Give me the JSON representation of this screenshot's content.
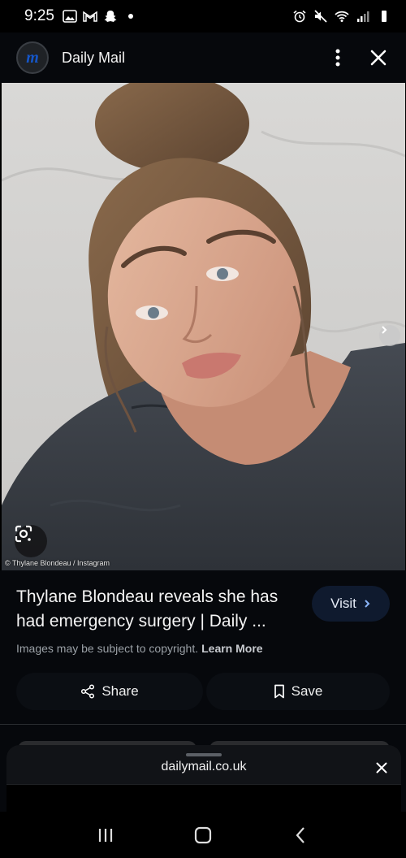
{
  "status_bar": {
    "time": "9:25",
    "left_icons": [
      "gallery-icon",
      "gmail-icon",
      "snapchat-icon",
      "dot-icon"
    ],
    "right_icons": [
      "alarm-icon",
      "mute-icon",
      "wifi-icon",
      "signal-icon",
      "battery-icon"
    ]
  },
  "header": {
    "logo_letter": "m",
    "title": "Daily Mail",
    "menu_icon": "more-vert-icon",
    "close_icon": "close-icon"
  },
  "image": {
    "credit": "© Thylane Blondeau / Instagram",
    "lens_icon": "google-lens-icon",
    "next_icon": "chevron-right-icon"
  },
  "result": {
    "title": "Thylane Blondeau reveals she has had emergency surgery | Daily ...",
    "visit_label": "Visit",
    "copyright_text": "Images may be subject to copyright.",
    "learn_more": "Learn More",
    "share_label": "Share",
    "save_label": "Save"
  },
  "sheet": {
    "domain": "dailymail.co.uk"
  },
  "nav": {
    "icons": [
      "recent-apps-icon",
      "home-icon",
      "back-icon"
    ]
  },
  "colors": {
    "background": "#000000",
    "panel": "#06080c",
    "visit_button": "#0f1a2e",
    "daily_mail_blue": "#1556c8"
  }
}
